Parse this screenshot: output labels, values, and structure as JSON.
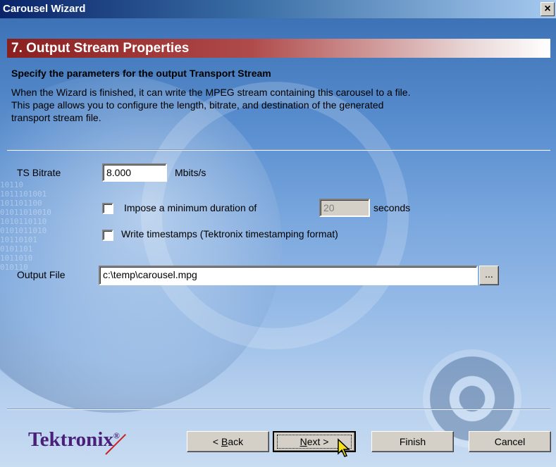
{
  "window": {
    "title": "Carousel Wizard",
    "close_label": "×"
  },
  "banner": {
    "title": "7. Output Stream Properties"
  },
  "section": {
    "subtitle": "Specify the parameters for the output Transport Stream",
    "description_line1": "When the Wizard is finished, it can write the MPEG stream containing this carousel to a file.",
    "description_line2": "This page allows you to configure the length, bitrate, and destination of the generated",
    "description_line3": "transport stream file."
  },
  "bitrate": {
    "label": "TS Bitrate",
    "value": "8.000",
    "unit": "Mbits/s"
  },
  "duration": {
    "label": "Impose a minimum duration of",
    "value": "20",
    "unit": "seconds",
    "checked": false
  },
  "timestamps": {
    "label": "Write timestamps (Tektronix timestamping format)",
    "checked": false
  },
  "output": {
    "label": "Output File",
    "value": "c:\\temp\\carousel.mpg",
    "browse_label": "..."
  },
  "buttons": {
    "back_prefix": "< ",
    "back_key": "B",
    "back_rest": "ack",
    "next_key": "N",
    "next_rest": "ext >",
    "finish": "Finish",
    "cancel": "Cancel"
  },
  "logo": {
    "text": "Tektronix",
    "mark": "®"
  },
  "background": {
    "binary_text": "10110\n1011101001\n101101100\n01011010010\n1010110110\n0101011010\n10110101\n0101101\n1011010\n010110"
  }
}
